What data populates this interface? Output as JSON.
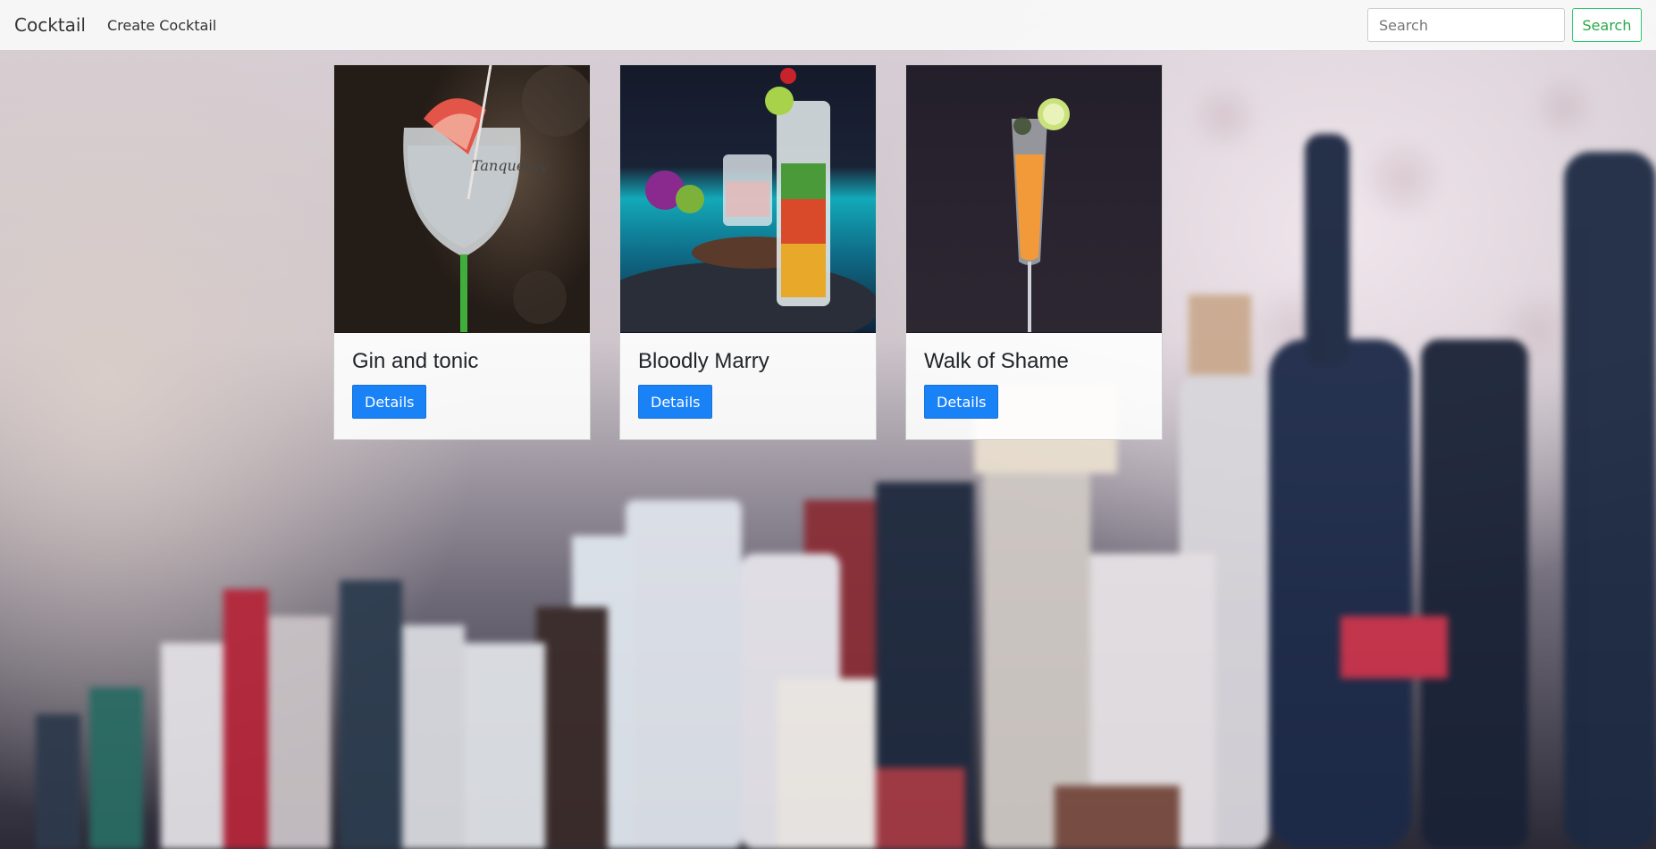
{
  "navbar": {
    "brand": "Cocktail",
    "links": [
      {
        "label": "Create Cocktail"
      }
    ],
    "search": {
      "placeholder": "Search",
      "value": "",
      "button_label": "Search"
    }
  },
  "cocktails": [
    {
      "name": "Gin and tonic",
      "button_label": "Details",
      "image": "gin-and-tonic-glass"
    },
    {
      "name": "Bloodly Marry",
      "button_label": "Details",
      "image": "mojito-style-glass"
    },
    {
      "name": "Walk of Shame",
      "button_label": "Details",
      "image": "orange-flute-glass"
    }
  ],
  "colors": {
    "primary_button": "#1a82f7",
    "search_button": "#28a745",
    "navbar_bg": "#f8f8f8"
  }
}
